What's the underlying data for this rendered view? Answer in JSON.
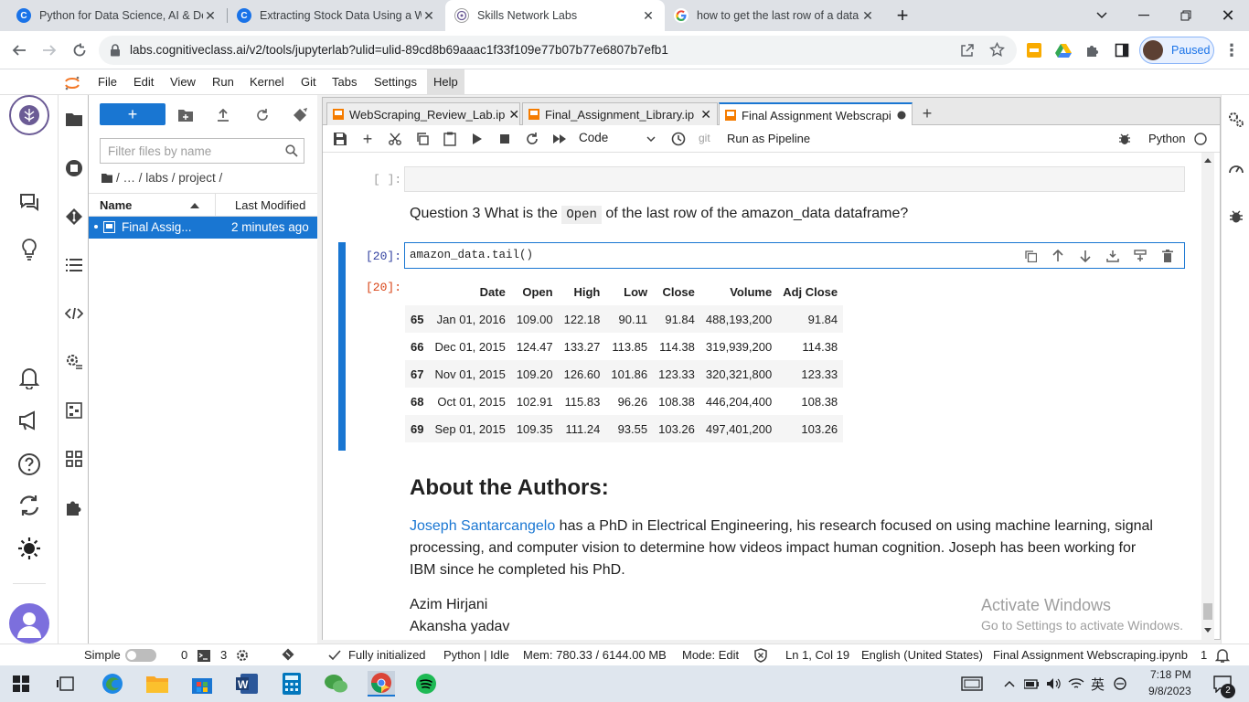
{
  "browser": {
    "tabs": [
      {
        "title": "Python for Data Science, AI & De",
        "icon": "coursera-c-icon",
        "active": false
      },
      {
        "title": "Extracting Stock Data Using a We",
        "icon": "coursera-c-icon",
        "active": false
      },
      {
        "title": "Skills Network Labs",
        "icon": "skills-network-icon",
        "active": true
      },
      {
        "title": "how to get the last row of a data",
        "icon": "google-g-icon",
        "active": false
      }
    ],
    "url": "labs.cognitiveclass.ai/v2/tools/jupyterlab?ulid=ulid-89cd8b69aaac1f33f109e77b07b77e6807b7efb1",
    "profile_status": "Paused"
  },
  "menubar": {
    "items": [
      "File",
      "Edit",
      "View",
      "Run",
      "Kernel",
      "Git",
      "Tabs",
      "Settings",
      "Help"
    ]
  },
  "file_browser": {
    "filter_placeholder": "Filter files by name",
    "breadcrumb": "/  …  / labs / project /",
    "col_name": "Name",
    "col_modified": "Last Modified",
    "files": [
      {
        "name": "Final Assig...",
        "modified": "2 minutes ago",
        "selected": true
      }
    ]
  },
  "doc_tabs": [
    {
      "title": "WebScraping_Review_Lab.ip",
      "active": false,
      "state": "close"
    },
    {
      "title": "Final_Assignment_Library.ip",
      "active": false,
      "state": "close"
    },
    {
      "title": "Final Assignment Webscrapi",
      "active": true,
      "state": "unsaved"
    }
  ],
  "notebook_toolbar": {
    "cell_type": "Code",
    "git_label": "git",
    "pipeline_label": "Run as Pipeline",
    "kernel_name": "Python"
  },
  "notebook": {
    "empty_prompt": "[ ]:",
    "question_prefix": "Question 3 What is the",
    "question_code": "Open",
    "question_suffix": "of the last row of the amazon_data dataframe?",
    "input_prompt": "[20]:",
    "code": "amazon_data.tail()",
    "output_prompt": "[20]:",
    "table": {
      "columns": [
        "",
        "Date",
        "Open",
        "High",
        "Low",
        "Close",
        "Volume",
        "Adj Close"
      ],
      "rows": [
        [
          "65",
          "Jan 01, 2016",
          "109.00",
          "122.18",
          "90.11",
          "91.84",
          "488,193,200",
          "91.84"
        ],
        [
          "66",
          "Dec 01, 2015",
          "124.47",
          "133.27",
          "113.85",
          "114.38",
          "319,939,200",
          "114.38"
        ],
        [
          "67",
          "Nov 01, 2015",
          "109.20",
          "126.60",
          "101.86",
          "123.33",
          "320,321,800",
          "123.33"
        ],
        [
          "68",
          "Oct 01, 2015",
          "102.91",
          "115.83",
          "96.26",
          "108.38",
          "446,204,400",
          "108.38"
        ],
        [
          "69",
          "Sep 01, 2015",
          "109.35",
          "111.24",
          "93.55",
          "103.26",
          "497,401,200",
          "103.26"
        ]
      ]
    },
    "authors_heading": "About the Authors:",
    "author1_link": "Joseph Santarcangelo",
    "author1_bio": " has a PhD in Electrical Engineering, his research focused on using machine learning, signal processing, and computer vision to determine how videos impact human cognition. Joseph has been working for IBM since he completed his PhD.",
    "author2": "Azim Hirjani",
    "author3": "Akansha yadav"
  },
  "watermark": {
    "line1": "Activate Windows",
    "line2": "Go to Settings to activate Windows."
  },
  "statusbar": {
    "mode_label": "Simple",
    "terminals": "0",
    "kernels": "3",
    "init_status": "Fully initialized",
    "kernel_status": "Python | Idle",
    "memory": "Mem: 780.33 / 6144.00 MB",
    "edit_mode": "Mode: Edit",
    "cursor_pos": "Ln 1, Col 19",
    "language": "English (United States)",
    "filename": "Final Assignment Webscraping.ipynb",
    "notifications": "1"
  },
  "taskbar": {
    "ime": "英",
    "time": "7:18 PM",
    "date": "9/8/2023",
    "notification_count": "2"
  },
  "colors": {
    "accent": "#1976d2",
    "chrome_tab_bg": "#dee1e6",
    "taskbar_bg": "#dfe6ee"
  }
}
